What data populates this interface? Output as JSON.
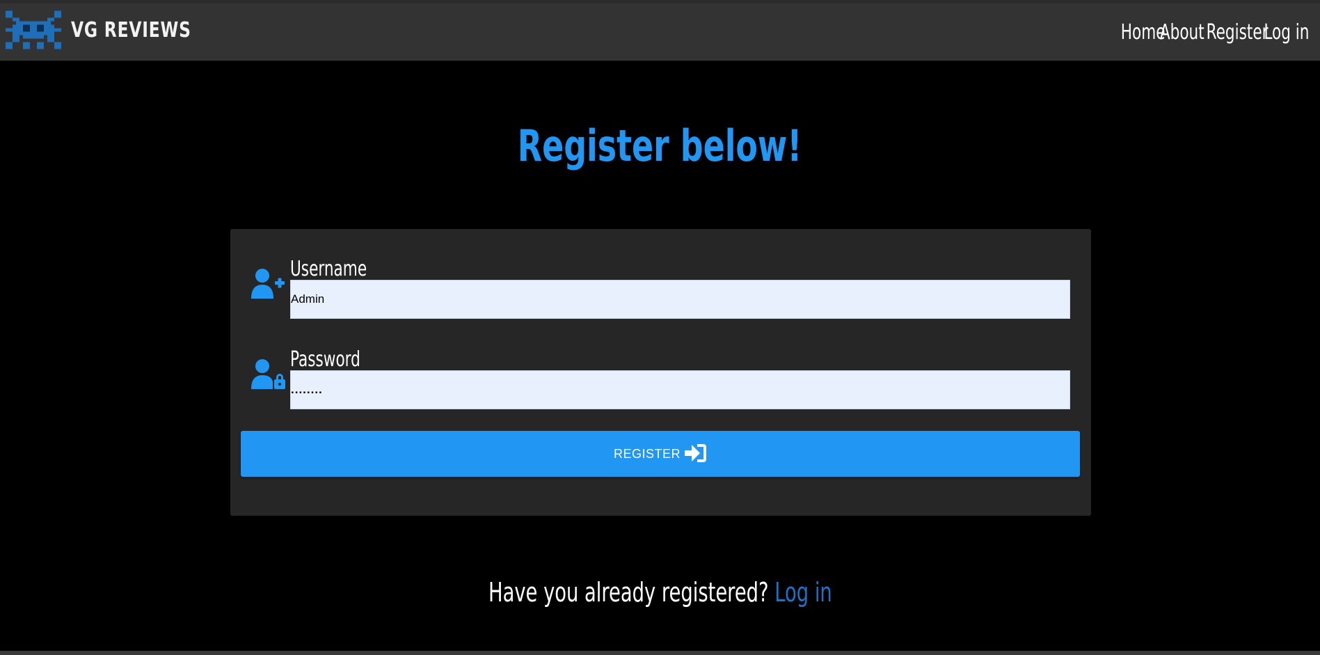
{
  "header": {
    "brand_name": "VG REVIEWS",
    "logo_icon": "space-invader-icon",
    "nav": [
      {
        "label": "Home"
      },
      {
        "label": "About"
      },
      {
        "label": "Register"
      },
      {
        "label": "Log in"
      }
    ]
  },
  "main": {
    "title": "Register below!",
    "form": {
      "username": {
        "label": "Username",
        "value": "Admin",
        "icon": "user-plus-icon"
      },
      "password": {
        "label": "Password",
        "value": "........",
        "icon": "user-lock-icon"
      },
      "submit": {
        "label": "REGISTER",
        "icon": "sign-in-icon"
      }
    },
    "footer": {
      "question": "Have you already registered?",
      "link_label": "Log in"
    }
  },
  "colors": {
    "accent": "#2196f3",
    "navbar": "#333333",
    "card": "#262626",
    "background": "#000000",
    "input_bg": "#e8f0fe",
    "link": "#1a73c9"
  }
}
